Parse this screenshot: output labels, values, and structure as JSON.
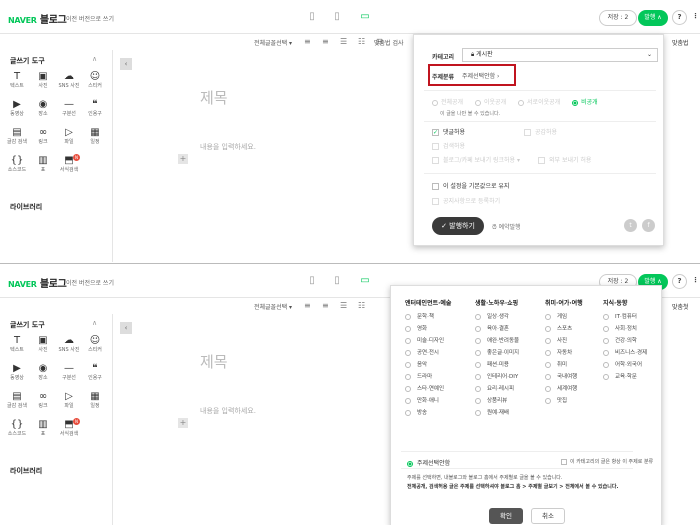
{
  "header": {
    "logo_naver": "NAVER",
    "logo_blog": "블로그",
    "prev_version": "이전 버전으로 쓰기",
    "draft_label": "저장",
    "draft_count": "2",
    "publish_label": "발행",
    "help": "?",
    "more": "⋮"
  },
  "toolbar": {
    "font_select": "전체글꼴선택",
    "spell_check": "맞춤법 검사",
    "right_edge_top": "맞춤법",
    "right_edge_bottom": "맞춤첫"
  },
  "sidebar": {
    "title": "글쓰기 도구",
    "tools": [
      {
        "icon": "T",
        "label": "텍스트"
      },
      {
        "icon": "▣",
        "label": "사진"
      },
      {
        "icon": "☁",
        "label": "SNS 사진"
      },
      {
        "icon": "☺",
        "label": "스티커"
      },
      {
        "icon": "▶",
        "label": "동영상"
      },
      {
        "icon": "◉",
        "label": "장소"
      },
      {
        "icon": "—",
        "label": "구분선"
      },
      {
        "icon": "❝",
        "label": "인용구"
      },
      {
        "icon": "▤",
        "label": "글감 검색"
      },
      {
        "icon": "∞",
        "label": "링크"
      },
      {
        "icon": "▷",
        "label": "파일"
      },
      {
        "icon": "▦",
        "label": "일정"
      },
      {
        "icon": "{}",
        "label": "소스코드"
      },
      {
        "icon": "▥",
        "label": "표"
      },
      {
        "icon": "⬒",
        "label": "서식검색",
        "badge": "N"
      }
    ],
    "library": "라이브러리"
  },
  "editor": {
    "title_placeholder": "제목",
    "body_placeholder": "내용을 입력하세요."
  },
  "publish_panel": {
    "category_label": "카테고리",
    "category_value": "게시판",
    "topic_label": "주제분류",
    "topic_value": "주제선택안함 ›",
    "visibility": [
      "전체공개",
      "이웃공개",
      "서로이웃공개",
      "비공개"
    ],
    "visibility_note": "이 글을 나만 볼 수 있습니다.",
    "allow_comments": "댓글허용",
    "allow_sympathy": "공감허용",
    "allow_search": "검색허용",
    "blog_cafe_share": "블로그/카페 보내기 링크허용 ▾",
    "outside_share": "외부 보내기 허용",
    "set_default": "이 설정을 기본값으로 유지",
    "notice": "공지사항으로 등록하기",
    "publish_button": "발행하기",
    "reserve": "예약발행"
  },
  "topic_panel": {
    "columns": [
      {
        "title": "엔터테인먼트·예술",
        "options": [
          "문학·책",
          "영화",
          "미술·디자인",
          "공연·전시",
          "음악",
          "드라마",
          "스타·연예인",
          "만화·애니",
          "방송"
        ]
      },
      {
        "title": "생활·노하우·쇼핑",
        "options": [
          "일상·생각",
          "육아·결혼",
          "애완·반려동물",
          "좋은글·이미지",
          "패션·미용",
          "인테리어·DIY",
          "요리·레시피",
          "상품리뷰",
          "원예·재배"
        ]
      },
      {
        "title": "취미·여가·여행",
        "options": [
          "게임",
          "스포츠",
          "사진",
          "자동차",
          "취미",
          "국내여행",
          "세계여행",
          "맛집"
        ]
      },
      {
        "title": "지식·동향",
        "options": [
          "IT·컴퓨터",
          "사회·정치",
          "건강·의학",
          "비즈니스·경제",
          "어학·외국어",
          "교육·학문"
        ]
      }
    ],
    "none_option": "주제선택안함",
    "always_apply": "이 카테고리의 글은 항상 이 주제로 분류",
    "desc1": "주제를 선택하면, 내블로그와 블로그 홈에서 주제별로 글을 볼 수 있습니다.",
    "desc2": "전체공개, 검색허용 글은 주제를 선택하셔야 블로그 홈 > 주제별 글보기 > 전체에서 볼 수 있습니다.",
    "confirm": "확인",
    "cancel": "취소"
  },
  "colors": {
    "accent": "#03c75a",
    "highlight": "#c0141f"
  }
}
